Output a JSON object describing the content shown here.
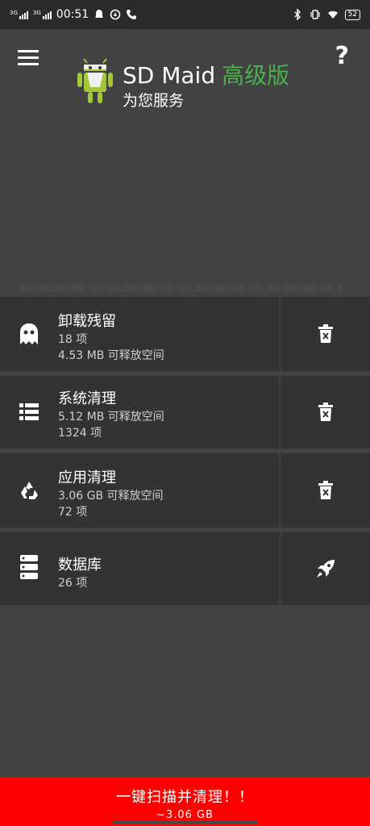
{
  "statusbar": {
    "time": "00:51",
    "signal1": "3G",
    "signal2": "3G",
    "battery": "52"
  },
  "header": {
    "app_name": "SD Maid",
    "edition": "高级版",
    "subtitle": "为您服务",
    "help": "?"
  },
  "tools": [
    {
      "name": "卸载残留",
      "line1": "18 项",
      "line2": "4.53 MB 可释放空间",
      "icon": "ghost-icon",
      "action_icon": "trash-icon"
    },
    {
      "name": "系统清理",
      "line1": "5.12 MB 可释放空间",
      "line2": "1324 项",
      "icon": "list-icon",
      "action_icon": "trash-icon"
    },
    {
      "name": "应用清理",
      "line1": "3.06 GB 可释放空间",
      "line2": "72 项",
      "icon": "recycle-icon",
      "action_icon": "trash-icon"
    },
    {
      "name": "数据库",
      "line1": "26 项",
      "icon": "database-icon",
      "action_icon": "rocket-icon"
    }
  ],
  "scan": {
    "label": "一键扫描并清理！！",
    "size": "~3.06 GB"
  },
  "colors": {
    "background": "#424242",
    "card": "#333333",
    "accent": "#4caf50",
    "scan_bar": "#ff0000"
  }
}
